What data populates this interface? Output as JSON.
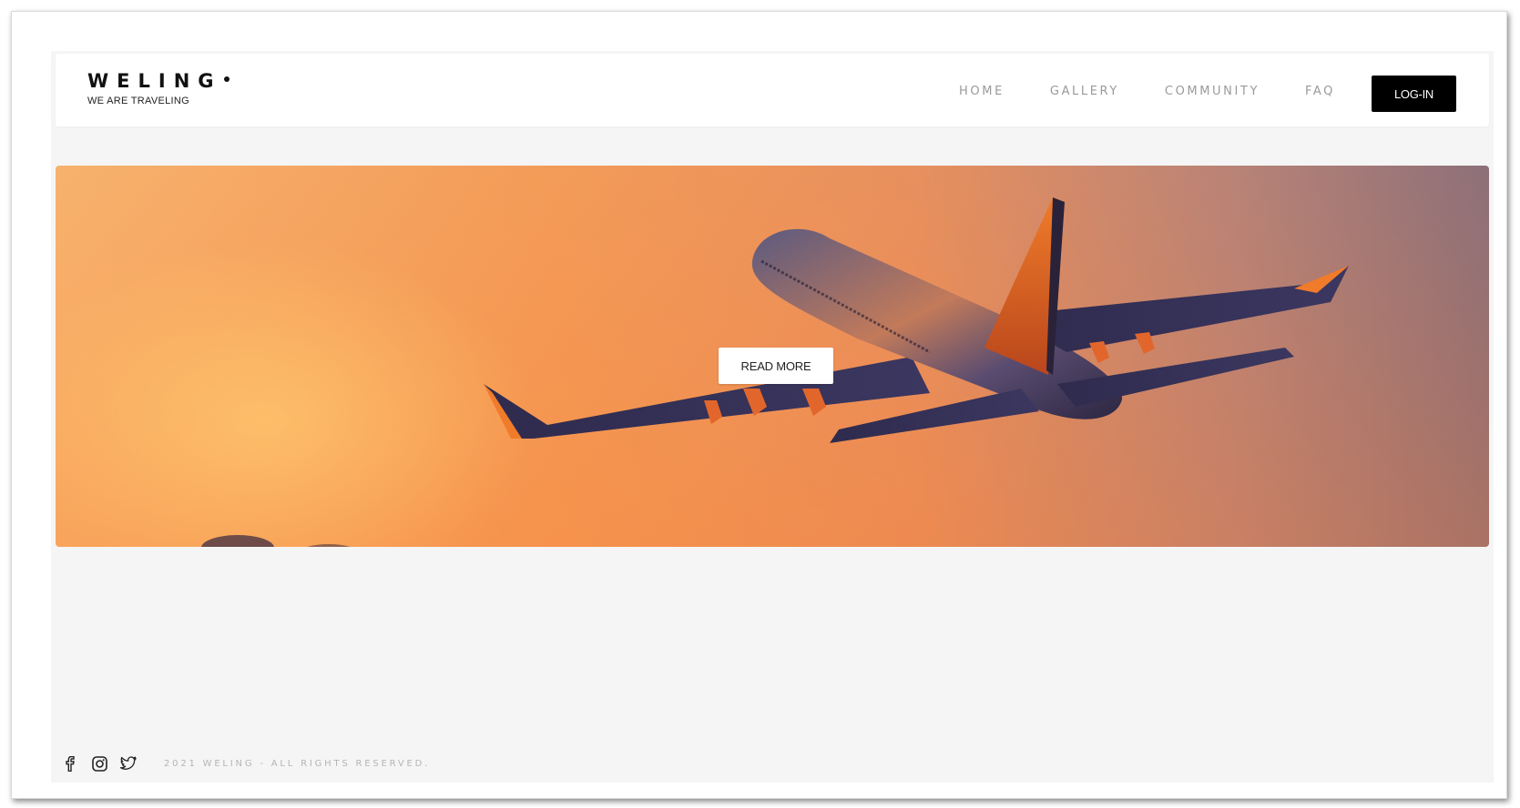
{
  "brand": {
    "title": "WELING",
    "tagline": "WE ARE TRAVELING"
  },
  "nav": {
    "items": [
      "HOME",
      "GALLERY",
      "COMMUNITY",
      "FAQ"
    ],
    "login_label": "LOG-IN"
  },
  "hero": {
    "image": "airplane-sunset",
    "button_label": "READ MORE"
  },
  "footer": {
    "social_icons": [
      "facebook-icon",
      "instagram-icon",
      "twitter-icon"
    ],
    "copyright": "2021 WELING - ALL RIGHTS RESERVED."
  },
  "colors": {
    "login_bg": "#000000",
    "nav_text": "#9a9a9a",
    "page_bg": "#f5f5f5"
  }
}
